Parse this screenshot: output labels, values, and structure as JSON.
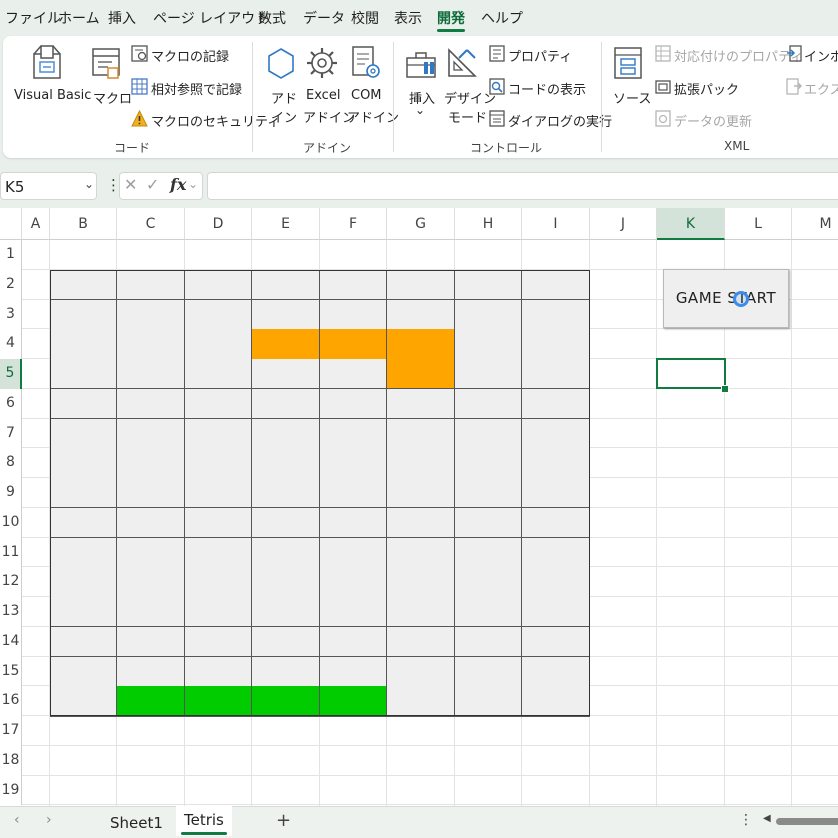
{
  "menu": {
    "items": [
      "ファイル",
      "ホーム",
      "挿入",
      "ページ レイアウト",
      "数式",
      "データ",
      "校閲",
      "表示",
      "開発",
      "ヘルプ"
    ],
    "active": "開発"
  },
  "ribbon": {
    "code": {
      "visual_basic": "Visual Basic",
      "macro": "マクロ",
      "record_macro": "マクロの記録",
      "relative_ref": "相対参照で記録",
      "macro_security": "マクロのセキュリティ",
      "label": "コード"
    },
    "addins": {
      "addin_1": "アド",
      "addin_2": "イン",
      "excel_1": "Excel",
      "excel_2": "アドイン",
      "com_1": "COM",
      "com_2": "アドイン",
      "label": "アドイン"
    },
    "controls": {
      "insert": "挿入",
      "insert_arrow": "⌄",
      "design_1": "デザイン",
      "design_2": "モード",
      "properties": "プロパティ",
      "view_code": "コードの表示",
      "run_dialog": "ダイアログの実行",
      "label": "コントロール"
    },
    "xml": {
      "source": "ソース",
      "map_properties": "対応付けのプロパティ",
      "expansion_packs": "拡張パック",
      "refresh_data": "データの更新",
      "import": "インポー",
      "export": "エクスポ",
      "label": "XML"
    }
  },
  "formula_bar": {
    "name_box": "K5",
    "name_box_arrow": "⌄",
    "dots": "⋮",
    "cancel": "✕",
    "enter": "✓",
    "fx": "fx",
    "fx_arrow": "⌄",
    "value": ""
  },
  "grid": {
    "columns": [
      "A",
      "B",
      "C",
      "D",
      "E",
      "F",
      "G",
      "H",
      "I",
      "J",
      "K",
      "L",
      "M"
    ],
    "rows": [
      "1",
      "2",
      "3",
      "4",
      "5",
      "6",
      "7",
      "8",
      "9",
      "10",
      "11",
      "12",
      "13",
      "14",
      "15",
      "16",
      "17",
      "18",
      "19"
    ],
    "selected_column": "K",
    "selected_row": "5",
    "active_cell": "K5"
  },
  "tetris": {
    "board_columns": [
      "B",
      "C",
      "D",
      "E",
      "F",
      "G",
      "H",
      "I"
    ],
    "board_rows": [
      "2",
      "3",
      "4",
      "5",
      "6",
      "7",
      "8",
      "9",
      "10",
      "11",
      "12",
      "13",
      "14",
      "15",
      "16"
    ],
    "orange_cells": [
      "E4",
      "F4",
      "G4",
      "G5"
    ],
    "green_cells": [
      "C16",
      "D16",
      "E16",
      "F16"
    ],
    "colors": {
      "empty": "#efefef",
      "orange": "#ffa500",
      "green": "#00cc00",
      "border": "#555555"
    }
  },
  "button": {
    "label": "GAME START"
  },
  "sheet_tabs": {
    "nav_prev": "‹",
    "nav_next": "›",
    "tabs": [
      "Sheet1",
      "Tetris"
    ],
    "active": "Tetris",
    "add": "+",
    "more": "⋮",
    "scroll_left": "◀"
  },
  "accent": "#107c41"
}
